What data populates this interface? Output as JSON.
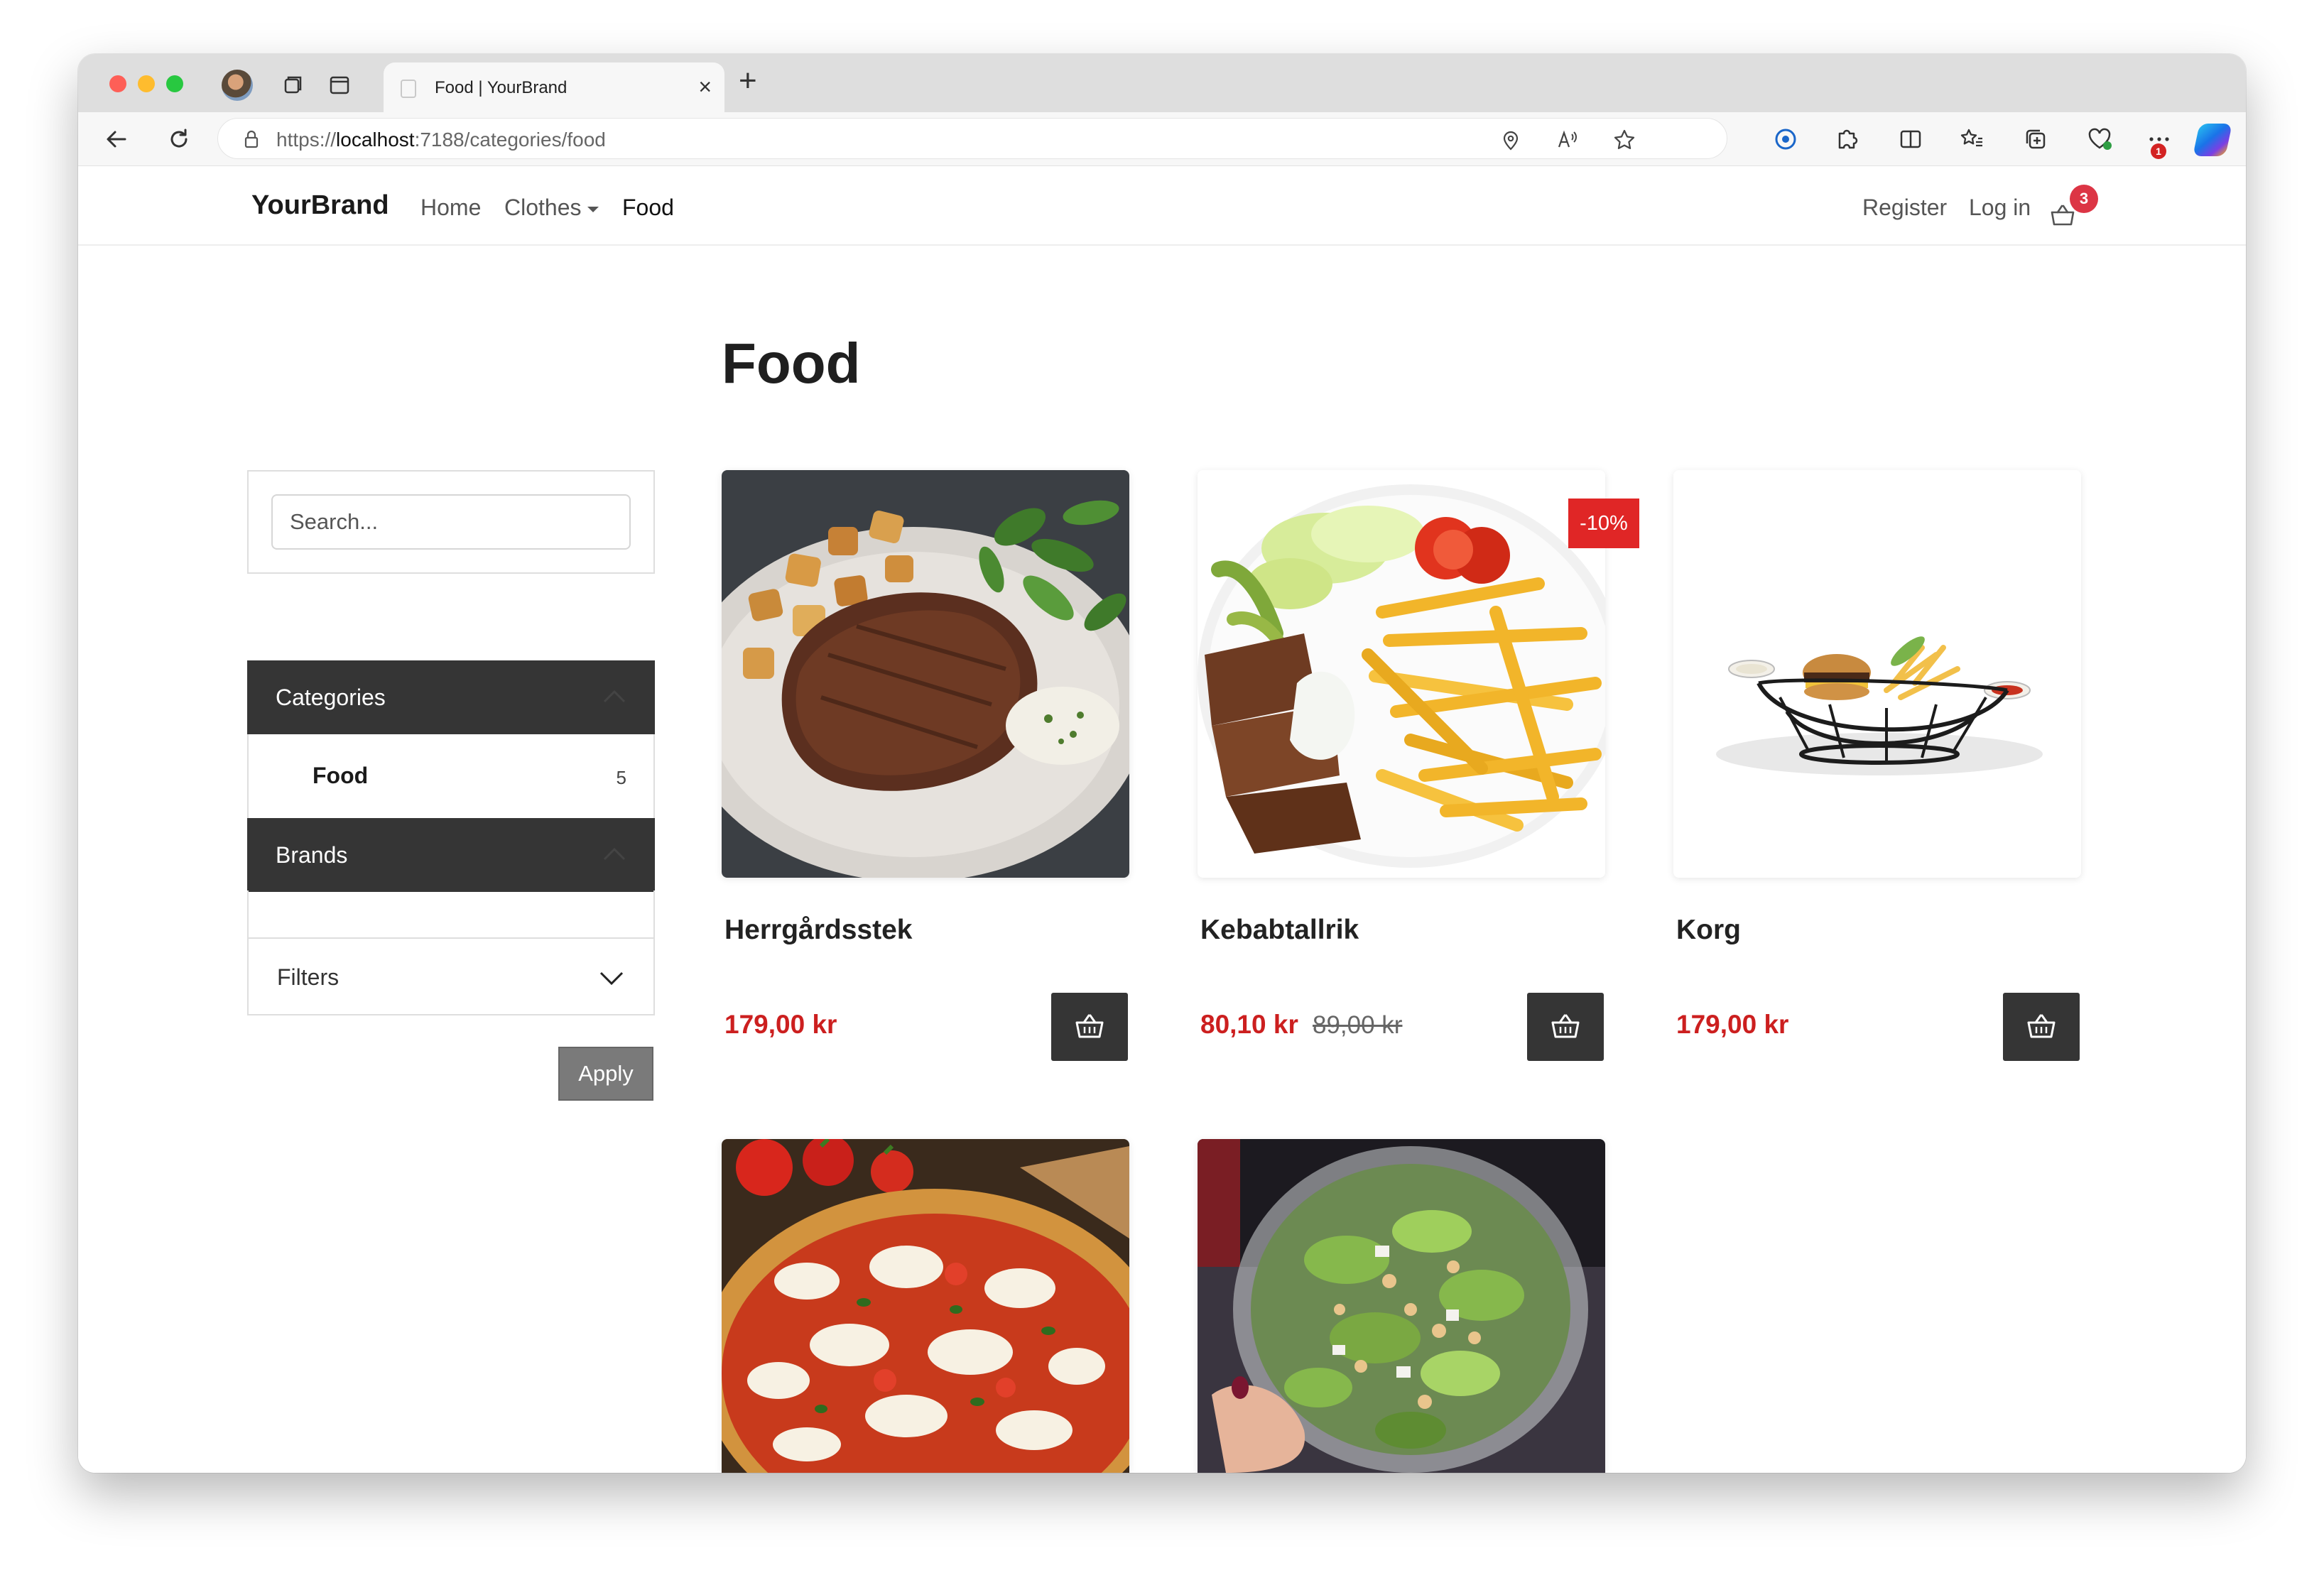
{
  "browser": {
    "tab_title": "Food | YourBrand",
    "url_prefix": "https://",
    "url_host": "localhost",
    "url_rest": ":7188/categories/food",
    "extension_badge": "1"
  },
  "site": {
    "brand": "YourBrand",
    "nav": {
      "home": "Home",
      "clothes": "Clothes",
      "food": "Food"
    },
    "register": "Register",
    "login": "Log in",
    "cart_count": "3"
  },
  "page": {
    "title": "Food"
  },
  "sidebar": {
    "search_placeholder": "Search...",
    "categories_label": "Categories",
    "category_items": [
      {
        "name": "Food",
        "count": "5"
      }
    ],
    "brands_label": "Brands",
    "filters_label": "Filters",
    "apply_label": "Apply"
  },
  "products": [
    {
      "name": "Herrgårdsstek",
      "price": "179,00 kr",
      "image": "steak-with-potatoes"
    },
    {
      "name": "Kebabtallrik",
      "price": "80,10 kr",
      "old_price": "89,00 kr",
      "badge": "-10%",
      "image": "kebab-plate-with-fries"
    },
    {
      "name": "Korg",
      "price": "179,00 kr",
      "image": "burger-basket"
    },
    {
      "image": "pizza-margherita"
    },
    {
      "image": "salad-bowl"
    }
  ],
  "colors": {
    "accent_red": "#cc1f1f",
    "badge_red": "#e02626",
    "dark": "#353535"
  }
}
